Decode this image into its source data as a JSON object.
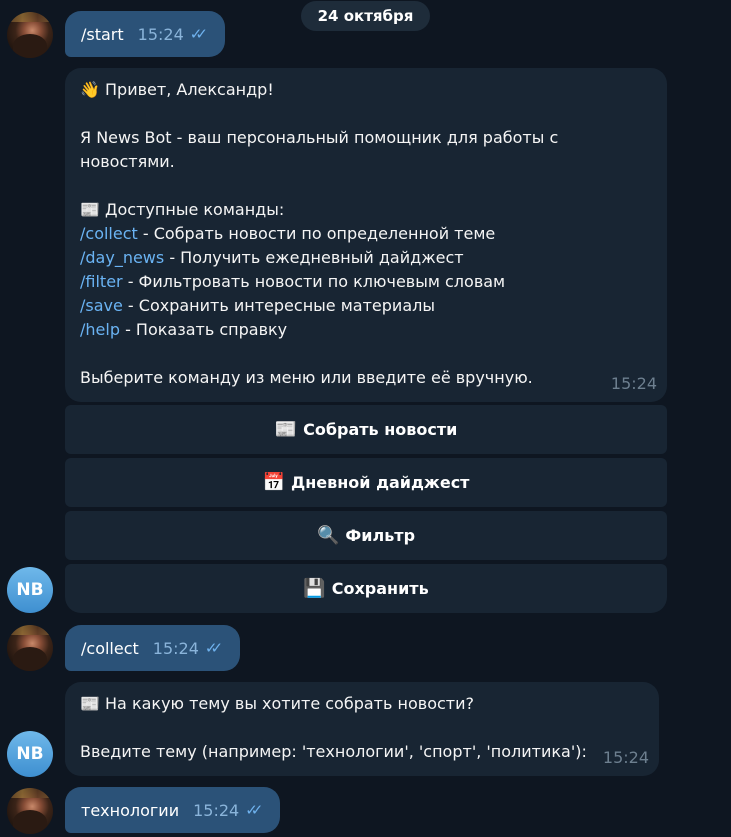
{
  "date_label": "24 октября",
  "bot_avatar_initials": "NB",
  "messages": {
    "start": {
      "text": "/start",
      "time": "15:24"
    },
    "welcome": {
      "greeting_emoji": "👋",
      "greeting": "Привет, Александр!",
      "intro": "Я News Bot - ваш персональный помощник для работы с новостями.",
      "commands_emoji": "📰",
      "commands_title": "Доступные команды:",
      "commands": [
        {
          "cmd": "/collect",
          "desc": " - Собрать новости по определенной теме"
        },
        {
          "cmd": "/day_news",
          "desc": " - Получить ежедневный дайджест"
        },
        {
          "cmd": "/filter",
          "desc": " - Фильтровать новости по ключевым словам"
        },
        {
          "cmd": "/save",
          "desc": " - Сохранить интересные материалы"
        },
        {
          "cmd": "/help",
          "desc": " - Показать справку"
        }
      ],
      "outro": "Выберите команду из меню или введите её вручную.",
      "time": "15:24"
    },
    "keyboard": [
      {
        "emoji": "📰",
        "label": "Собрать новости"
      },
      {
        "emoji": "📅",
        "label": "Дневной дайджест"
      },
      {
        "emoji": "🔍",
        "label": "Фильтр"
      },
      {
        "emoji": "💾",
        "label": "Сохранить"
      }
    ],
    "collect": {
      "text": "/collect",
      "time": "15:24"
    },
    "topic_prompt": {
      "emoji": "📰",
      "question": "На какую тему вы хотите собрать новости?",
      "hint": "Введите тему (например: 'технологии', 'спорт', 'политика'):",
      "time": "15:24"
    },
    "topic_reply": {
      "text": "технологии",
      "time": "15:24"
    }
  }
}
